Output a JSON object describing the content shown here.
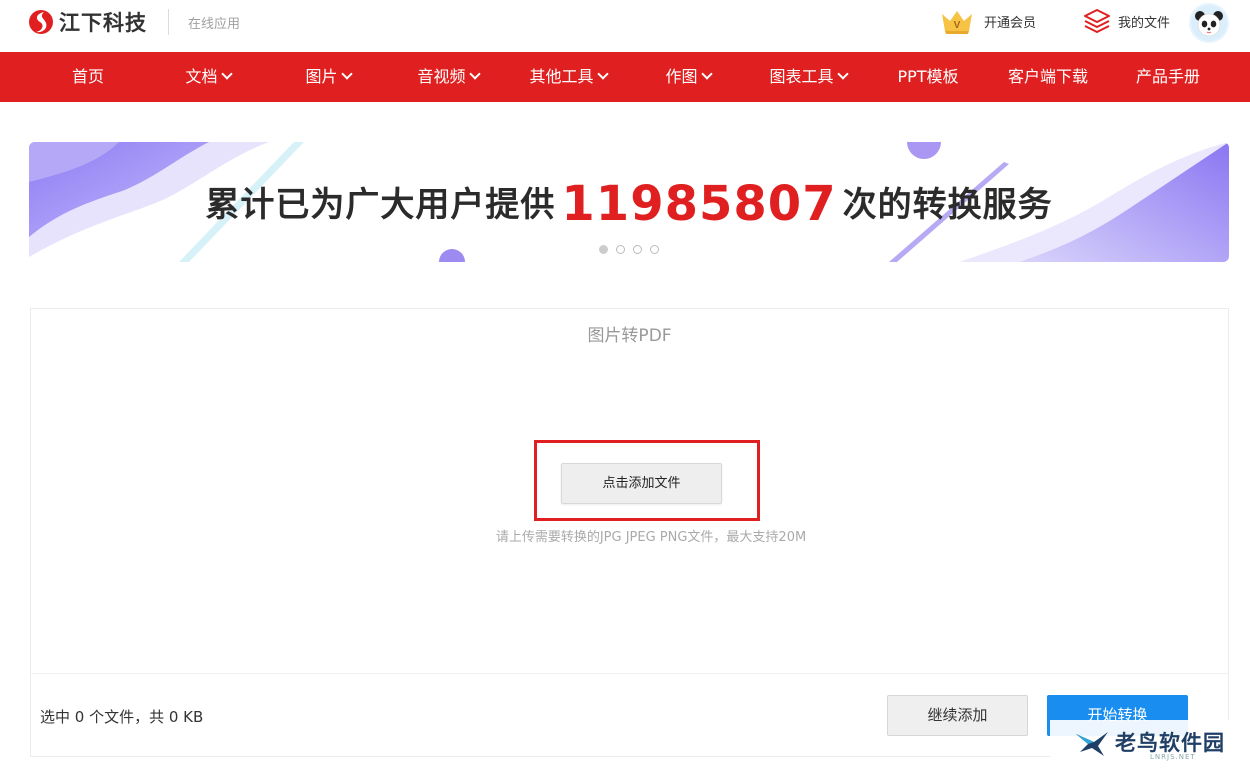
{
  "header": {
    "brand_name": "江下科技",
    "brand_sub": "在线应用",
    "vip_label": "开通会员",
    "files_label": "我的文件",
    "brand_color": "#e02020"
  },
  "nav": {
    "items": [
      {
        "label": "首页",
        "dropdown": false
      },
      {
        "label": "文档",
        "dropdown": true
      },
      {
        "label": "图片",
        "dropdown": true
      },
      {
        "label": "音视频",
        "dropdown": true
      },
      {
        "label": "其他工具",
        "dropdown": true
      },
      {
        "label": "作图",
        "dropdown": true
      },
      {
        "label": "图表工具",
        "dropdown": true
      },
      {
        "label": "PPT模板",
        "dropdown": false
      },
      {
        "label": "客户端下载",
        "dropdown": false
      },
      {
        "label": "产品手册",
        "dropdown": false
      }
    ]
  },
  "banner": {
    "prefix": "累计已为广大用户提供",
    "count": "11985807",
    "suffix": "次的转换服务",
    "slide_count": 4,
    "active_slide": 1
  },
  "tool": {
    "title": "图片转PDF",
    "add_button": "点击添加文件",
    "hint": "请上传需要转换的JPG JPEG PNG文件，最大支持20M",
    "selection_info": "选中 0 个文件，共 0 KB",
    "continue_button": "继续添加",
    "start_button": "开始转换",
    "accent_color": "#1a8ef0"
  },
  "watermark": {
    "text": "老鸟软件园",
    "sub": "LNRJS.NET"
  }
}
